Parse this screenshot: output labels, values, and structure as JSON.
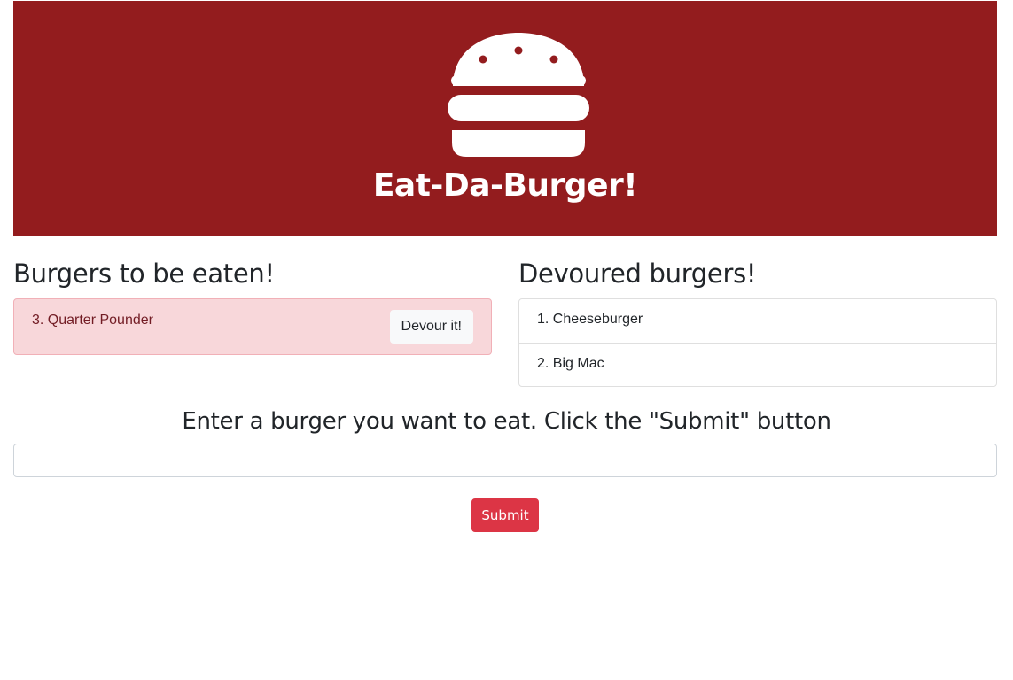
{
  "header": {
    "logo_icon": "hamburger-icon",
    "title": "Eat-Da-Burger!",
    "background_color": "#931c1e"
  },
  "pending": {
    "title": "Burgers to be eaten!",
    "items": [
      {
        "label": "3. Quarter Pounder",
        "button_label": "Devour it!"
      }
    ]
  },
  "devoured": {
    "title": "Devoured burgers!",
    "items": [
      {
        "label": "1. Cheeseburger"
      },
      {
        "label": "2. Big Mac"
      }
    ]
  },
  "form": {
    "title": "Enter a burger you want to eat. Click the \"Submit\" button",
    "input_value": "",
    "input_placeholder": "",
    "submit_label": "Submit",
    "submit_color": "#dc3545"
  }
}
